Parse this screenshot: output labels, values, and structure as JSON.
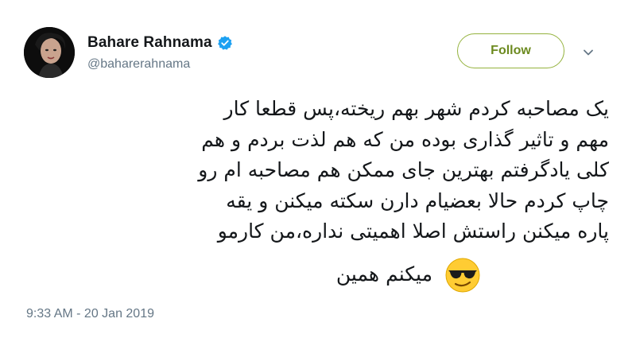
{
  "user": {
    "display_name": "Bahare Rahnama",
    "handle": "@baharerahnama"
  },
  "actions": {
    "follow_label": "Follow"
  },
  "icons": {
    "verified": "verified-badge-icon",
    "caret": "chevron-down-icon",
    "emoji": "smiling-face-with-sunglasses-emoji"
  },
  "tweet": {
    "body": "یک مصاحبه کردم شهر بهم ریخته،پس قطعا کار\nمهم و تاثیر گذاری بوده من که هم لذت بردم و هم\nکلی یادگرفتم بهترین جای ممکن هم مصاحبه ام رو\nچاپ کردم حالا بعضیام دارن سکته میکنن و یقه\nپاره میکنن راستش اصلا اهمیتی نداره،من کارمو",
    "last_line": "میکنم همین",
    "timestamp": "9:33 AM - 20 Jan 2019"
  },
  "colors": {
    "follow_border": "#94b23d",
    "follow_text": "#6c8a1f",
    "verified_blue": "#1da1f2",
    "secondary_text": "#657786"
  }
}
